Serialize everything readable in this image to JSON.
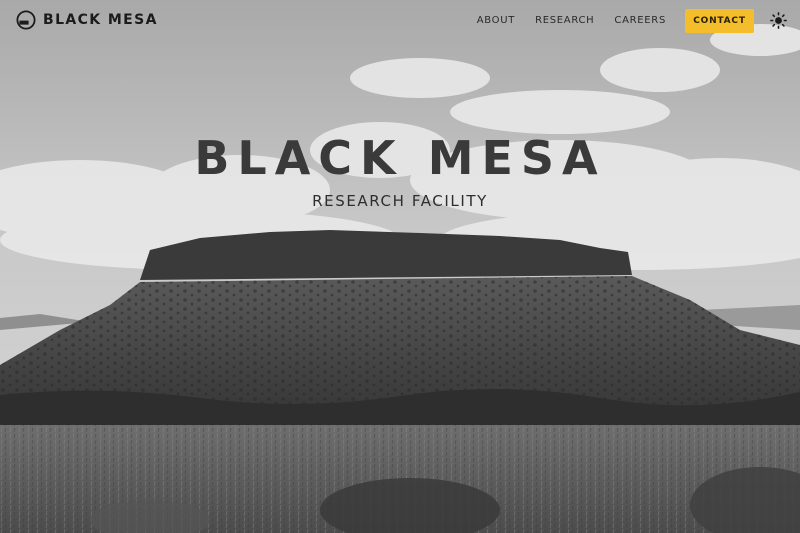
{
  "brand": {
    "name": "BLACK MESA",
    "logo_icon": "black-mesa-logo-icon"
  },
  "nav": {
    "links": [
      "ABOUT",
      "RESEARCH",
      "CAREERS"
    ],
    "contact_label": "CONTACT",
    "theme_icon": "sun-icon"
  },
  "hero": {
    "title": "BLACK MESA",
    "subtitle": "RESEARCH FACILITY"
  },
  "colors": {
    "accent": "#f4bd2c",
    "text_dark": "#1b1b1b"
  }
}
